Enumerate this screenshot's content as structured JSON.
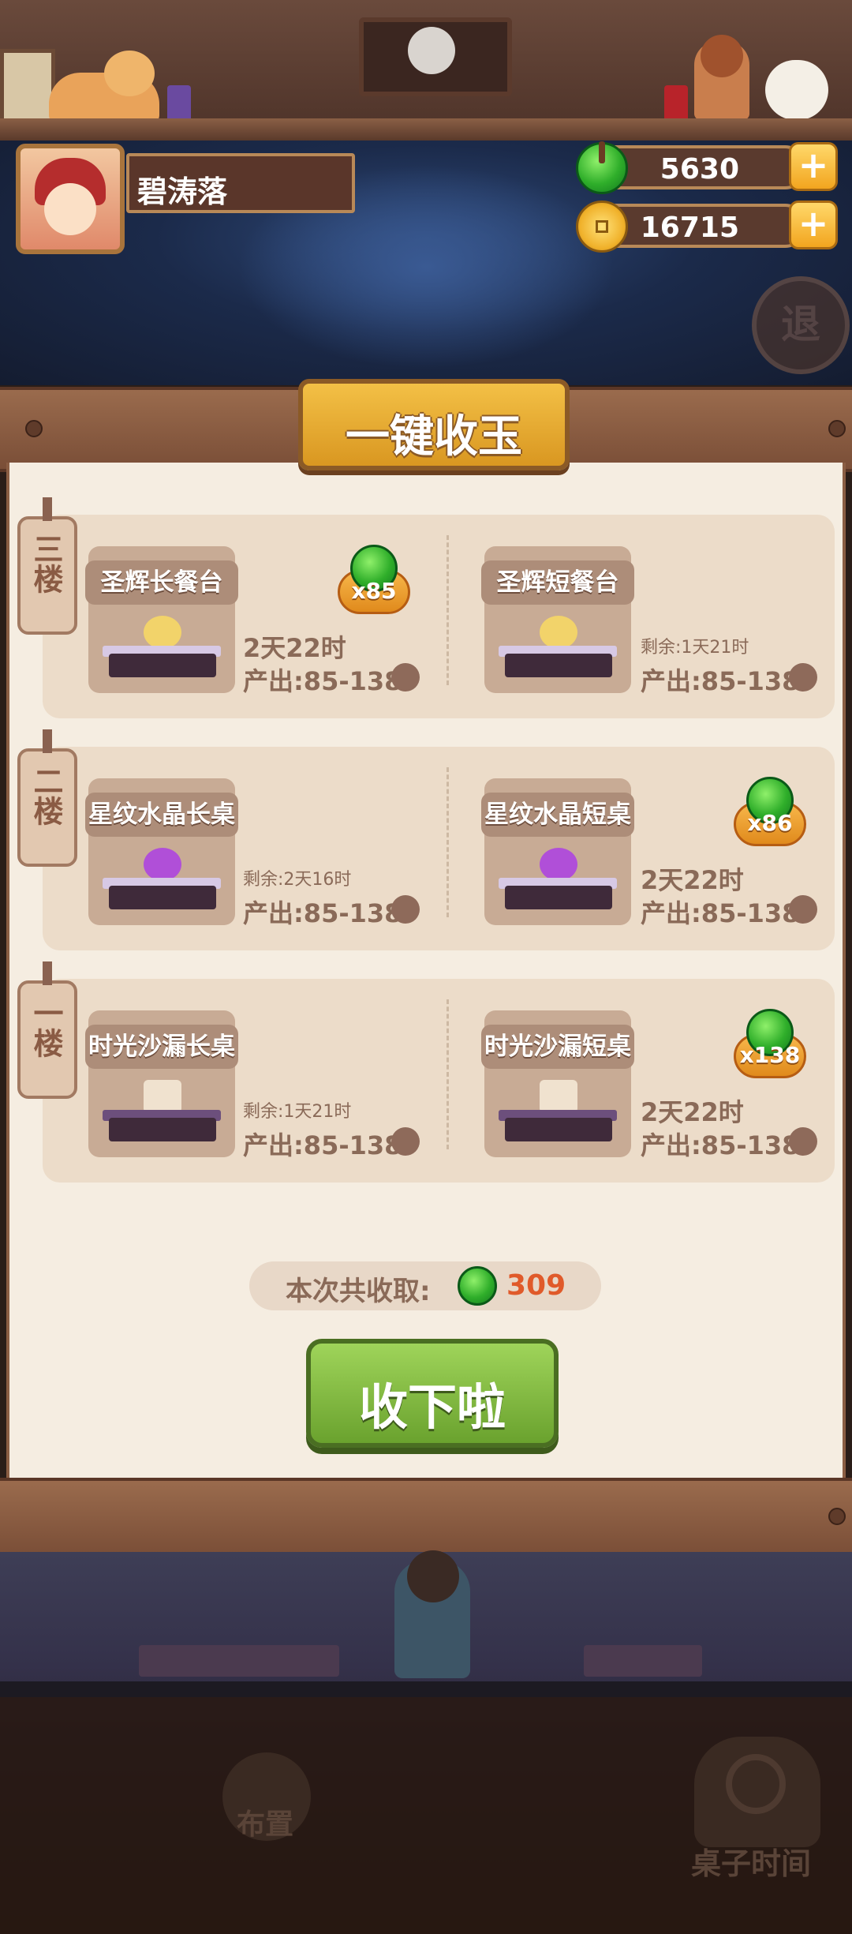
{
  "player": {
    "name": "碧涛落"
  },
  "currencies": {
    "jade": "5630",
    "coins": "16715"
  },
  "exit_button": "退",
  "dialog": {
    "title": "一键收玉",
    "floors": [
      {
        "label": "三楼",
        "left": {
          "name": "圣辉长餐台",
          "status_big": "2天22时",
          "status_small": "",
          "production": "产出:85-138",
          "badge": "x85"
        },
        "right": {
          "name": "圣辉短餐台",
          "status_big": "",
          "status_small": "剩余:1天21时",
          "production": "产出:85-138",
          "badge": ""
        }
      },
      {
        "label": "二楼",
        "left": {
          "name": "星纹水晶长桌",
          "status_big": "",
          "status_small": "剩余:2天16时",
          "production": "产出:85-138",
          "badge": ""
        },
        "right": {
          "name": "星纹水晶短桌",
          "status_big": "2天22时",
          "status_small": "",
          "production": "产出:85-138",
          "badge": "x86"
        }
      },
      {
        "label": "一楼",
        "left": {
          "name": "时光沙漏长桌",
          "status_big": "",
          "status_small": "剩余:1天21时",
          "production": "产出:85-138",
          "badge": ""
        },
        "right": {
          "name": "时光沙漏短桌",
          "status_big": "2天22时",
          "status_small": "",
          "production": "产出:85-138",
          "badge": "x138"
        }
      }
    ],
    "total_label": "本次共收取:",
    "total_value": "309",
    "collect_button": "收下啦"
  },
  "bottom_nav": {
    "layout": "布置",
    "table_time": "桌子时间"
  },
  "icons": [
    "jade-icon",
    "coin-icon",
    "plus-icon",
    "exit-icon",
    "clock-icon"
  ],
  "colors": {
    "accent_gold": "#f3c046",
    "collect_green": "#8cc34a",
    "total_red": "#e05a2a"
  }
}
